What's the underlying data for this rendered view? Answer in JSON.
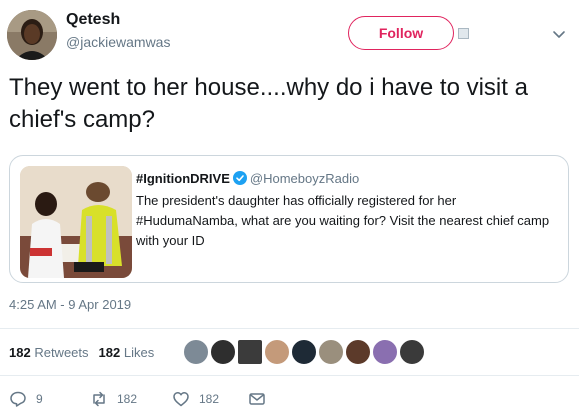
{
  "author": {
    "display_name": "Qetesh",
    "handle": "@jackiewamwas"
  },
  "follow_button": {
    "label": "Follow",
    "accent": "#e0245e"
  },
  "tweet": {
    "text": "They went to her house....why do i have to visit a chief's camp?",
    "timestamp": "4:25 AM - 9 Apr 2019"
  },
  "quoted_tweet": {
    "display_name": "#IgnitionDRIVE",
    "verified": true,
    "handle": "@HomeboyzRadio",
    "text": "The president's daughter has officially registered for her #HudumaNamba, what are you waiting for? Visit the nearest chief camp with your ID"
  },
  "stats": {
    "retweets_count": "182",
    "retweets_label": "Retweets",
    "likes_count": "182",
    "likes_label": "Likes"
  },
  "actions": {
    "reply_count": "9",
    "retweet_count": "182",
    "like_count": "182"
  },
  "icons": {
    "verified": "verified-badge-icon",
    "reply": "reply-icon",
    "retweet": "retweet-icon",
    "like": "heart-icon",
    "message": "envelope-icon",
    "caret": "chevron-down-icon"
  },
  "colors": {
    "text_primary": "#14171a",
    "text_secondary": "#657786",
    "verified_blue": "#1da1f2",
    "border": "#ccd6dd"
  }
}
